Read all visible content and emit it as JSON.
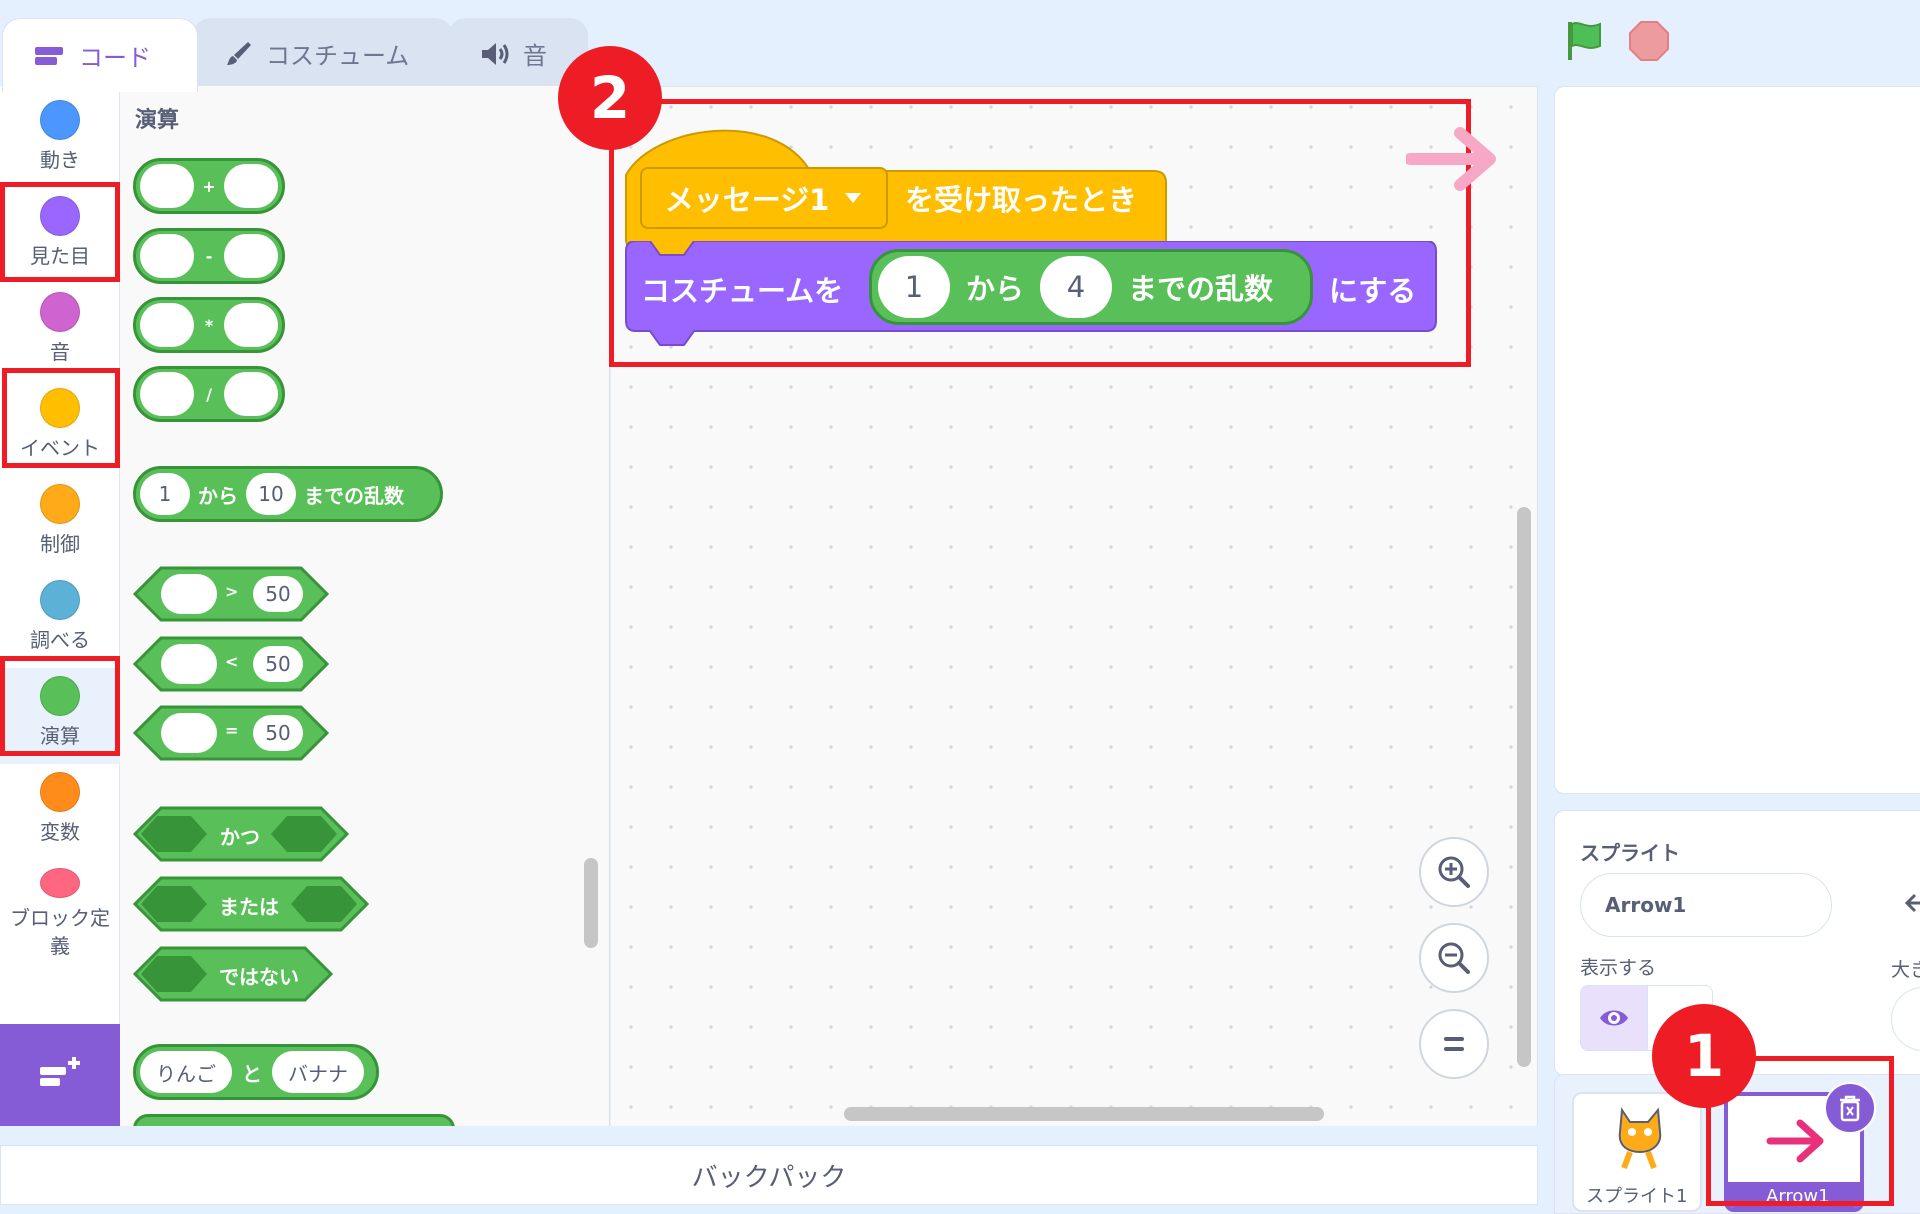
{
  "tabs": {
    "code": "コード",
    "costume": "コスチューム",
    "sound": "音"
  },
  "categories": [
    {
      "label": "動き",
      "color": "#4c97ff"
    },
    {
      "label": "見た目",
      "color": "#9966ff"
    },
    {
      "label": "音",
      "color": "#cf63cf"
    },
    {
      "label": "イベント",
      "color": "#ffbf00"
    },
    {
      "label": "制御",
      "color": "#ffab19"
    },
    {
      "label": "調べる",
      "color": "#5cb1d6"
    },
    {
      "label": "演算",
      "color": "#59c059"
    },
    {
      "label": "変数",
      "color": "#ff8c1a"
    },
    {
      "label": "ブロック定義",
      "color": "#ff6680"
    }
  ],
  "palette": {
    "title": "演算",
    "ops": [
      "+",
      "-",
      "*",
      "/"
    ],
    "random": {
      "from": "1",
      "text1": "から",
      "to": "10",
      "text2": "までの乱数"
    },
    "compare": [
      {
        "op": ">",
        "value": "50"
      },
      {
        "op": "<",
        "value": "50"
      },
      {
        "op": "=",
        "value": "50"
      }
    ],
    "logic": [
      "かつ",
      "または",
      "ではない"
    ],
    "join": {
      "a": "りんご",
      "text": "と",
      "b": "バナナ"
    }
  },
  "script": {
    "hat_dropdown": "メッセージ1",
    "hat_text": "を受け取ったとき",
    "looks_text1": "コスチュームを",
    "from": "1",
    "from_text": "から",
    "to": "4",
    "rand_text": "までの乱数",
    "looks_text2": "にする"
  },
  "sprite_info": {
    "label": "スプライト",
    "name": "Arrow1",
    "show_label": "表示する",
    "size_label": "大き"
  },
  "sprites": [
    "スプライト1",
    "Arrow1"
  ],
  "backpack": "バックパック",
  "badges": [
    "1",
    "2"
  ],
  "colors": {
    "accent": "#855cd6",
    "highlight": "#ee1c24",
    "operators": "#59c059",
    "events": "#ffbf00",
    "looks": "#9966ff"
  }
}
